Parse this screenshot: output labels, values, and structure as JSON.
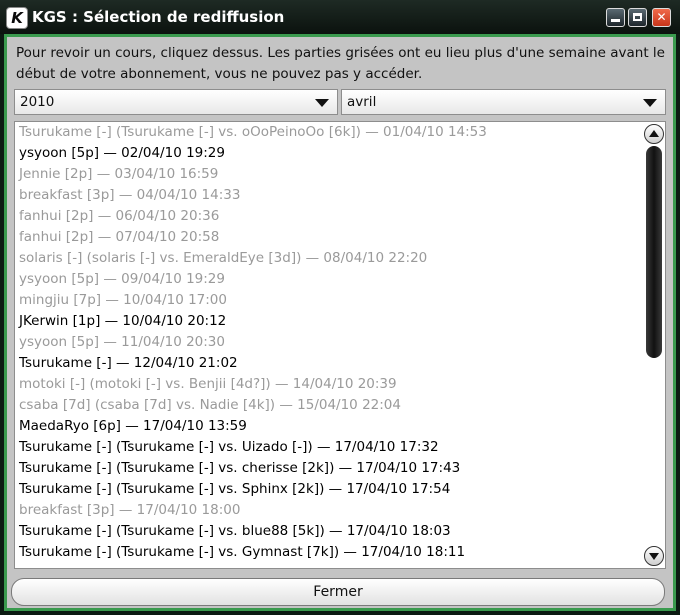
{
  "window": {
    "title": "KGS : Sélection de rediffusion",
    "logo_letter": "K",
    "controls": {
      "minimize": "minimize",
      "maximize": "maximize",
      "close": "✕"
    }
  },
  "instructions": "Pour revoir un cours, cliquez dessus. Les parties grisées ont eu lieu plus d'une semaine avant le début de votre abonnement, vous ne pouvez pas y accéder.",
  "filters": {
    "year": "2010",
    "month": "avril"
  },
  "replays": [
    {
      "text": "Tsurukame [-] (Tsurukame [-] vs. oOoPeinoOo [6k]) — 01/04/10 14:53",
      "available": false
    },
    {
      "text": "ysyoon [5p] — 02/04/10 19:29",
      "available": true
    },
    {
      "text": "Jennie [2p] — 03/04/10 16:59",
      "available": false
    },
    {
      "text": "breakfast [3p] — 04/04/10 14:33",
      "available": false
    },
    {
      "text": "fanhui [2p] — 06/04/10 20:36",
      "available": false
    },
    {
      "text": "fanhui [2p] — 07/04/10 20:58",
      "available": false
    },
    {
      "text": "solaris [-] (solaris [-] vs. EmeraldEye [3d]) — 08/04/10 22:20",
      "available": false
    },
    {
      "text": "ysyoon [5p] — 09/04/10 19:29",
      "available": false
    },
    {
      "text": "mingjiu [7p] — 10/04/10 17:00",
      "available": false
    },
    {
      "text": "JKerwin [1p] — 10/04/10 20:12",
      "available": true
    },
    {
      "text": "ysyoon [5p] — 11/04/10 20:30",
      "available": false
    },
    {
      "text": "Tsurukame [-] — 12/04/10 21:02",
      "available": true
    },
    {
      "text": "motoki [-] (motoki [-] vs. Benjii [4d?]) — 14/04/10 20:39",
      "available": false
    },
    {
      "text": "csaba [7d] (csaba [7d] vs. Nadie [4k]) — 15/04/10 22:04",
      "available": false
    },
    {
      "text": "MaedaRyo [6p] — 17/04/10 13:59",
      "available": true
    },
    {
      "text": "Tsurukame [-] (Tsurukame [-] vs. Uizado [-]) — 17/04/10 17:32",
      "available": true
    },
    {
      "text": "Tsurukame [-] (Tsurukame [-] vs. cherisse [2k]) — 17/04/10 17:43",
      "available": true
    },
    {
      "text": "Tsurukame [-] (Tsurukame [-] vs. Sphinx [2k]) — 17/04/10 17:54",
      "available": true
    },
    {
      "text": "breakfast [3p] — 17/04/10 18:00",
      "available": false
    },
    {
      "text": "Tsurukame [-] (Tsurukame [-] vs. blue88 [5k]) — 17/04/10 18:03",
      "available": true
    },
    {
      "text": "Tsurukame [-] (Tsurukame [-] vs. Gymnast [7k]) — 17/04/10 18:11",
      "available": true
    }
  ],
  "buttons": {
    "close": "Fermer"
  },
  "colors": {
    "frame_accent": "#3a9a4e",
    "unavailable_text": "#9a9a9a",
    "available_text": "#000000"
  },
  "icons": {
    "scroll_up": "arrow-up-icon",
    "scroll_down": "arrow-down-icon",
    "dropdown": "chevron-down-icon"
  }
}
